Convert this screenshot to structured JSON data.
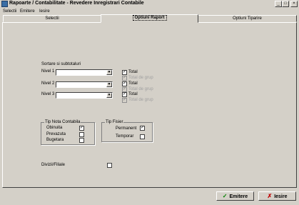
{
  "window": {
    "title": "Rapoarte / Contabilitate - Revedere Inregistrari Contabile",
    "min_glyph": "_",
    "max_glyph": "□",
    "close_glyph": "×"
  },
  "menu": {
    "items": [
      "Selectii",
      "Emitere",
      "Iesire"
    ]
  },
  "tabs": [
    {
      "label": "Selectii",
      "active": false
    },
    {
      "label": "Optiuni Raport",
      "active": true
    },
    {
      "label": "Optiuni Tiparire",
      "active": false
    }
  ],
  "sort": {
    "heading": "Sortare si subtotaluri",
    "levels": [
      {
        "label": "Nivel 1",
        "value": "",
        "total_label": "Total",
        "total_checked": true,
        "group_label": "Total de grup",
        "group_checked": true
      },
      {
        "label": "Nivel 2",
        "value": "",
        "total_label": "Total",
        "total_checked": true,
        "group_label": "Total de grup",
        "group_checked": true
      },
      {
        "label": "Nivel 3",
        "value": "",
        "total_label": "Total",
        "total_checked": true,
        "group_label": "Total de grup",
        "group_checked": true
      }
    ]
  },
  "nota": {
    "title": "Tip Nota Contabila",
    "items": [
      {
        "label": "Obinuita",
        "checked": true
      },
      {
        "label": "Prevazuta",
        "checked": false
      },
      {
        "label": "Bugetara",
        "checked": false
      }
    ]
  },
  "fisier": {
    "title": "Tip Fisier",
    "items": [
      {
        "label": "Permanent",
        "checked": true
      },
      {
        "label": "Temporar",
        "checked": false
      }
    ]
  },
  "divizii": {
    "label": "Divizii/Filiale",
    "checked": false
  },
  "buttons": {
    "emit_label": "Emitere",
    "exit_label": "Iesire",
    "emit_icon_color": "#008000",
    "exit_icon_color": "#c00000"
  },
  "check_glyph": "✓",
  "dropdown_glyph": "▼"
}
